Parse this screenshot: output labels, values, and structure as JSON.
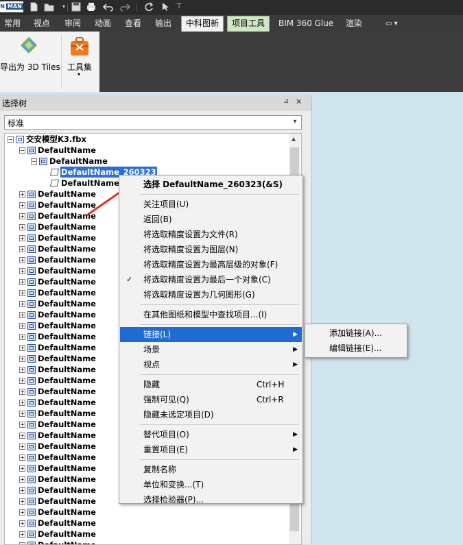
{
  "quick_access": {
    "logo_left": "N",
    "logo_right": "MAN",
    "icons": [
      "new-file-icon",
      "open-file-icon",
      "dropdown-icon",
      "save-icon",
      "print-icon",
      "undo-icon",
      "redo-icon",
      "refresh-icon",
      "pointer-icon",
      "customize-icon"
    ]
  },
  "ribbon_tabs": [
    "常用",
    "视点",
    "审阅",
    "动画",
    "查看",
    "输出",
    "中科图新",
    "项目工具",
    "BIM 360 Glue",
    "渲染"
  ],
  "ribbon_tab_extra": "▭ ▾",
  "ribbon": {
    "export_label": "导出为 3D Tiles",
    "toolset_label": "工具集",
    "toolset_arrow": "▾"
  },
  "selection_tree": {
    "title": "选择树",
    "pin_icon": "⊿",
    "close_icon": "✕",
    "mode_value": "标准",
    "root": "交安模型K3.fbx",
    "level1": "DefaultName",
    "level2": "DefaultName",
    "selected_item": "DefaultName_260323",
    "sibling_item": "DefaultName_",
    "collapsed_items": [
      "DefaultName",
      "DefaultName",
      "DefaultName",
      "DefaultName",
      "DefaultName",
      "DefaultName",
      "DefaultName",
      "DefaultName",
      "DefaultName",
      "DefaultName",
      "DefaultName",
      "DefaultName",
      "DefaultName",
      "DefaultName",
      "DefaultName",
      "DefaultName",
      "DefaultName",
      "DefaultName",
      "DefaultName",
      "DefaultName",
      "DefaultName",
      "DefaultName",
      "DefaultName",
      "DefaultName",
      "DefaultName",
      "DefaultName",
      "DefaultName",
      "DefaultName",
      "DefaultName",
      "DefaultName",
      "DefaultName",
      "DefaultName",
      "DefaultName"
    ]
  },
  "context_menu": {
    "header": "选择 DefaultName_260323(&S)",
    "groups": [
      [
        {
          "label": "关注项目(U)"
        },
        {
          "label": "返回(B)"
        },
        {
          "label": "将选取精度设置为文件(R)"
        },
        {
          "label": "将选取精度设置为图层(N)"
        },
        {
          "label": "将选取精度设置为最高层级的对象(F)"
        },
        {
          "label": "将选取精度设置为最后一个对象(C)",
          "checked": "✓"
        },
        {
          "label": "将选取精度设置为几何图形(G)"
        }
      ],
      [
        {
          "label": "在其他图纸和模型中查找项目...(I)"
        }
      ],
      [
        {
          "label": "链接(L)",
          "submenu": "▶",
          "highlighted": true
        },
        {
          "label": "场景",
          "submenu": "▶"
        },
        {
          "label": "视点",
          "submenu": "▶"
        }
      ],
      [
        {
          "label": "隐藏",
          "shortcut": "Ctrl+H"
        },
        {
          "label": "强制可见(Q)",
          "shortcut": "Ctrl+R"
        },
        {
          "label": "隐藏未选定项目(D)"
        }
      ],
      [
        {
          "label": "替代项目(O)",
          "submenu": "▶"
        },
        {
          "label": "重置项目(E)",
          "submenu": "▶"
        }
      ],
      [
        {
          "label": "复制名称"
        },
        {
          "label": "单位和变换...(T)"
        },
        {
          "label": "选择检验器(P)..."
        }
      ]
    ]
  },
  "submenu": {
    "items": [
      "添加链接(A)...",
      "编辑链接(E)..."
    ]
  },
  "colors": {
    "highlight": "#1f6bd1",
    "annotation_arrow": "#e8301e",
    "viewport": "#d0e4ee"
  }
}
